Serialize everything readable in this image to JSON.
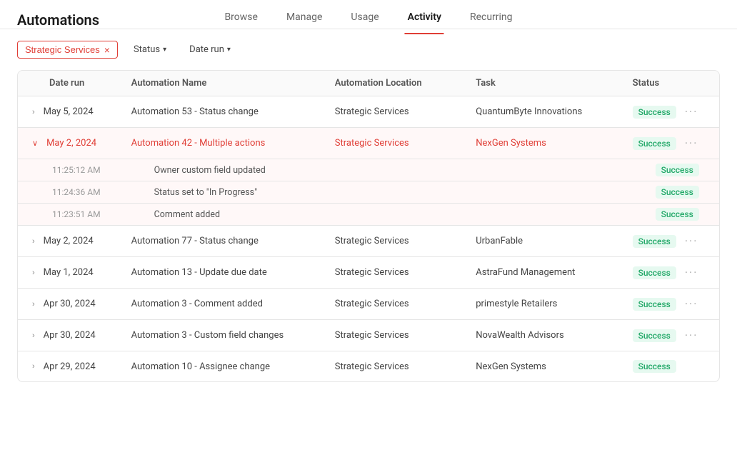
{
  "header": {
    "title": "Automations",
    "tabs": [
      {
        "id": "browse",
        "label": "Browse",
        "active": false
      },
      {
        "id": "manage",
        "label": "Manage",
        "active": false
      },
      {
        "id": "usage",
        "label": "Usage",
        "active": false
      },
      {
        "id": "activity",
        "label": "Activity",
        "active": true
      },
      {
        "id": "recurring",
        "label": "Recurring",
        "active": false
      }
    ]
  },
  "filters": {
    "tag_label": "Strategic Services",
    "tag_close": "×",
    "status_label": "Status",
    "date_run_label": "Date run"
  },
  "table": {
    "columns": [
      "Date run",
      "Automation Name",
      "Automation Location",
      "Task",
      "Status"
    ],
    "rows": [
      {
        "id": "row1",
        "expand": ">",
        "date": "May 5, 2024",
        "automation_name": "Automation 53 - Status change",
        "location": "Strategic Services",
        "task": "QuantumByte Innovations",
        "status": "Success",
        "expanded": false
      },
      {
        "id": "row2",
        "expand": "v",
        "date": "May 2, 2024",
        "automation_name": "Automation 42 - Multiple actions",
        "location": "Strategic Services",
        "task": "NexGen Systems",
        "status": "Success",
        "expanded": true,
        "sub_rows": [
          {
            "time": "11:25:12 AM",
            "action": "Owner custom field updated",
            "status": "Success"
          },
          {
            "time": "11:24:36 AM",
            "action": "Status set to \"In Progress\"",
            "status": "Success"
          },
          {
            "time": "11:23:51 AM",
            "action": "Comment added",
            "status": "Success"
          }
        ]
      },
      {
        "id": "row3",
        "expand": ">",
        "date": "May 2, 2024",
        "automation_name": "Automation 77 - Status change",
        "location": "Strategic Services",
        "task": "UrbanFable",
        "status": "Success",
        "expanded": false
      },
      {
        "id": "row4",
        "expand": ">",
        "date": "May 1, 2024",
        "automation_name": "Automation 13 - Update due date",
        "location": "Strategic Services",
        "task": "AstraFund Management",
        "status": "Success",
        "expanded": false
      },
      {
        "id": "row5",
        "expand": ">",
        "date": "Apr 30, 2024",
        "automation_name": "Automation 3 - Comment added",
        "location": "Strategic Services",
        "task": "primestyle Retailers",
        "status": "Success",
        "expanded": false
      },
      {
        "id": "row6",
        "expand": ">",
        "date": "Apr 30, 2024",
        "automation_name": "Automation 3 - Custom field changes",
        "location": "Strategic Services",
        "task": "NovaWealth Advisors",
        "status": "Success",
        "expanded": false
      },
      {
        "id": "row7",
        "expand": ">",
        "date": "Apr 29, 2024",
        "automation_name": "Automation 10 - Assignee change",
        "location": "Strategic Services",
        "task": "NexGen Systems",
        "status": "Success",
        "expanded": false
      }
    ]
  }
}
